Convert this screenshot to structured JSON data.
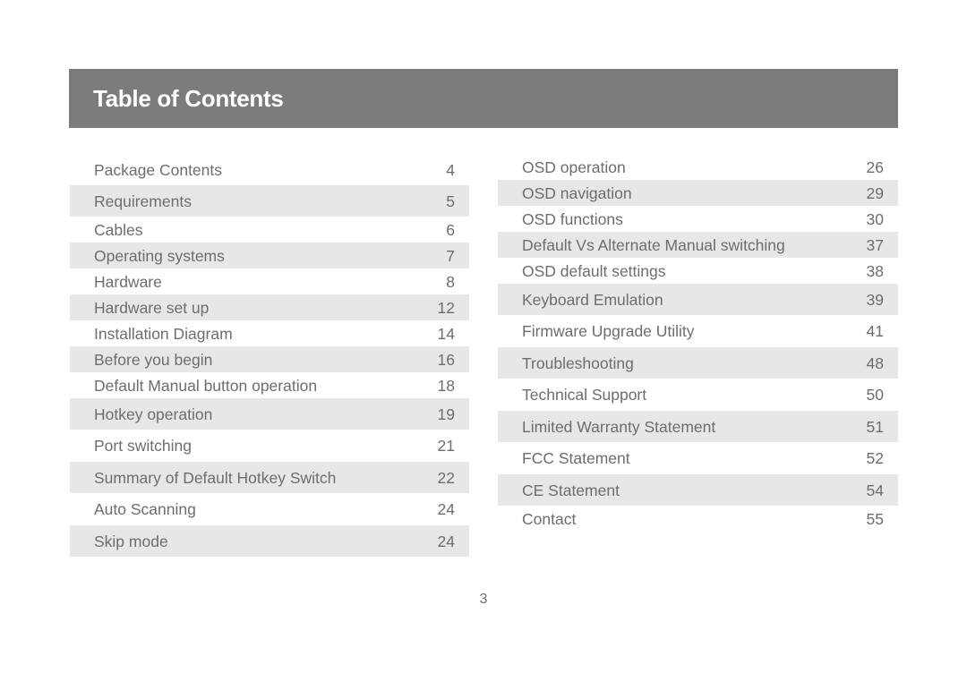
{
  "header": {
    "title": "Table of Contents"
  },
  "left_column": [
    {
      "label": "Package Contents",
      "page": "4",
      "shaded": false
    },
    {
      "label": "Requirements",
      "page": "5",
      "shaded": true
    },
    {
      "label": "Cables",
      "page": "6",
      "shaded": false
    },
    {
      "label": "Operating systems",
      "page": "7",
      "shaded": true
    },
    {
      "label": "Hardware",
      "page": "8",
      "shaded": false
    },
    {
      "label": "Hardware set up",
      "page": "12",
      "shaded": true
    },
    {
      "label": "Installation Diagram",
      "page": "14",
      "shaded": false
    },
    {
      "label": "Before you begin",
      "page": "16",
      "shaded": true
    },
    {
      "label": "Default Manual button operation",
      "page": "18",
      "shaded": false
    },
    {
      "label": "Hotkey operation",
      "page": "19",
      "shaded": true
    },
    {
      "label": "Port switching",
      "page": "21",
      "shaded": false
    },
    {
      "label": "Summary of Default Hotkey Switch",
      "page": "22",
      "shaded": true
    },
    {
      "label": "Auto Scanning",
      "page": "24",
      "shaded": false
    },
    {
      "label": "Skip mode",
      "page": "24",
      "shaded": true
    }
  ],
  "right_column": [
    {
      "label": "OSD operation",
      "page": "26",
      "shaded": false
    },
    {
      "label": "OSD navigation",
      "page": "29",
      "shaded": true
    },
    {
      "label": "OSD functions",
      "page": "30",
      "shaded": false
    },
    {
      "label": "Default Vs Alternate Manual switching",
      "page": "37",
      "shaded": true
    },
    {
      "label": "OSD default settings",
      "page": "38",
      "shaded": false
    },
    {
      "label": "Keyboard Emulation",
      "page": "39",
      "shaded": true
    },
    {
      "label": "Firmware Upgrade Utility",
      "page": "41",
      "shaded": false
    },
    {
      "label": "Troubleshooting",
      "page": "48",
      "shaded": true
    },
    {
      "label": "Technical Support",
      "page": "50",
      "shaded": false
    },
    {
      "label": "Limited Warranty Statement",
      "page": "51",
      "shaded": true
    },
    {
      "label": "FCC Statement",
      "page": "52",
      "shaded": false
    },
    {
      "label": "CE Statement",
      "page": "54",
      "shaded": true
    },
    {
      "label": "Contact",
      "page": "55",
      "shaded": false
    }
  ],
  "footer": {
    "page_number": "3"
  },
  "colors": {
    "header_bg": "#7c7d7a",
    "shade": "#e7e7e6",
    "text": "#6d6e6b"
  }
}
